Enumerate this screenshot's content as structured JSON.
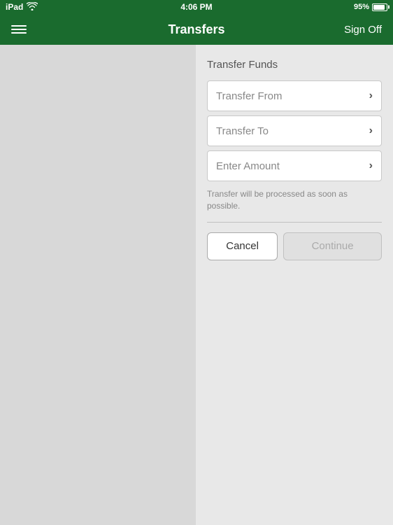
{
  "statusBar": {
    "carrier": "iPad",
    "time": "4:06 PM",
    "battery": "95%",
    "wifi": true
  },
  "navBar": {
    "title": "Transfers",
    "signOff": "Sign Off"
  },
  "transferFunds": {
    "sectionTitle": "Transfer Funds",
    "transferFrom": {
      "label": "Transfer From",
      "chevron": "›"
    },
    "transferTo": {
      "label": "Transfer To",
      "chevron": "›"
    },
    "enterAmount": {
      "label": "Enter Amount",
      "chevron": "›"
    },
    "note": "Transfer will be processed as soon as possible.",
    "cancelButton": "Cancel",
    "continueButton": "Continue"
  }
}
